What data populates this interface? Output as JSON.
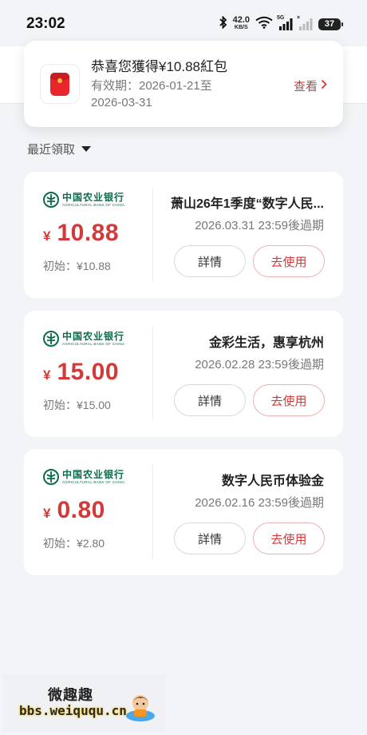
{
  "status_bar": {
    "time": "23:02",
    "net_speed_value": "42.0",
    "net_speed_unit": "KB/S",
    "sim1_tag": "5G",
    "sim2_tag": "×",
    "battery": "37"
  },
  "notice": {
    "icon": "red-packet-icon",
    "title": "恭喜您獲得¥10.88紅包",
    "validity_line1": "有效期：2026-01-21至",
    "validity_line2": "2026-03-31",
    "view_label": "查看"
  },
  "filter": {
    "label": "最近領取"
  },
  "bank": {
    "name_cn": "中国农业银行",
    "name_en": "AGRICULTURAL BANK OF CHINA"
  },
  "cards": [
    {
      "currency": "¥",
      "amount": "10.88",
      "initial": "初始：¥10.88",
      "title": "萧山26年1季度“数字人民...",
      "expiry": "2026.03.31 23:59後過期",
      "detail_label": "詳情",
      "use_label": "去使用"
    },
    {
      "currency": "¥",
      "amount": "15.00",
      "initial": "初始：¥15.00",
      "title": "金彩生活，惠享杭州",
      "expiry": "2026.02.28 23:59後過期",
      "detail_label": "詳情",
      "use_label": "去使用"
    },
    {
      "currency": "¥",
      "amount": "0.80",
      "initial": "初始：¥2.80",
      "title": "数字人民币体验金",
      "expiry": "2026.02.16 23:59後過期",
      "detail_label": "詳情",
      "use_label": "去使用"
    }
  ],
  "watermark": {
    "name": "微趣趣",
    "url": "bbs.weiququ.cn"
  },
  "colors": {
    "accent_red": "#d23a3a",
    "bank_green": "#0b6b4a",
    "background": "#f3f4f7"
  }
}
